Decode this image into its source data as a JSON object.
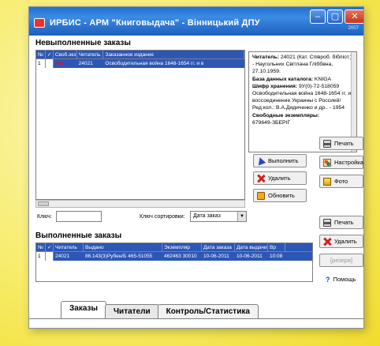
{
  "window": {
    "title": "ИРБИС - АРМ \"Книговыдача\" - Вінницький ДПУ",
    "year": "2007",
    "controls": [
      "–",
      "▢",
      "✕"
    ]
  },
  "pending": {
    "title": "Невыполненные заказы",
    "columns": [
      "№",
      "✓",
      "Своб.экз.",
      "Читатель",
      "Заказанное издание"
    ],
    "rows": [
      {
        "num": "1",
        "check": "",
        "free": "Нет",
        "reader": "24021",
        "item": "Освободительная война 1648-1654 гг. и в"
      }
    ]
  },
  "info": {
    "reader_label": "Читатель:",
    "reader_value": "24021 (Кат. Співроб. бібліот.) - Наугольних Світлана Гліббвна, 27.10.1959.",
    "db_label": "База данных каталога:",
    "db_value": "KNIGA",
    "cipher_label": "Шифр хранения:",
    "cipher_value": "9У(0)-72-518059",
    "desc": "Освободительная война 1648-1654 гг. и воссоединение Украины с Россией/ Ред.кол.: В.А.Дядиченко и др.. - 1954",
    "free_label": "Свободные экземпляры:",
    "free_value": "679649-ЗБЕРІГ"
  },
  "buttons": {
    "print_top": "Печать",
    "execute": "Выполнить",
    "settings": "Настройка",
    "delete_top": "Удалить",
    "photo": "Фото",
    "refresh": "Обновить",
    "print_bottom": "Печать",
    "delete_bottom": "Удалить",
    "reserve": "[резерв]",
    "help": "Помощь"
  },
  "icons": {
    "print": "printer-icon",
    "execute": "execute-icon",
    "settings": "settings-icon",
    "delete": "delete-x-icon",
    "photo": "photo-icon",
    "refresh": "refresh-icon",
    "help": "help-icon"
  },
  "key": {
    "label": "Ключ:",
    "value": ""
  },
  "sort": {
    "label": "Ключ сортировки:",
    "value": "Дата заказ"
  },
  "done": {
    "title": "Выполненные заказы",
    "columns": [
      "№",
      "✓",
      "Читатель",
      "Выдано",
      "Экземпляр",
      "Дата заказа",
      "Дата выдачи",
      "Вр"
    ],
    "rows": [
      {
        "num": "1",
        "check": "",
        "reader": "24021",
        "issued": "86.143(3)Рубен/Б 465-51055",
        "copy": "462463 30010",
        "order_date": "10-06-2011",
        "issue_date": "10-06-2011",
        "time": "10:08"
      }
    ]
  },
  "tabs": [
    "Заказы",
    "Читатели",
    "Контроль/Статистика"
  ],
  "colors": {
    "title_bar": "#1f6fcf",
    "selection": "#2d57b6",
    "background": "#f6e94e",
    "marker": "#e01010"
  }
}
